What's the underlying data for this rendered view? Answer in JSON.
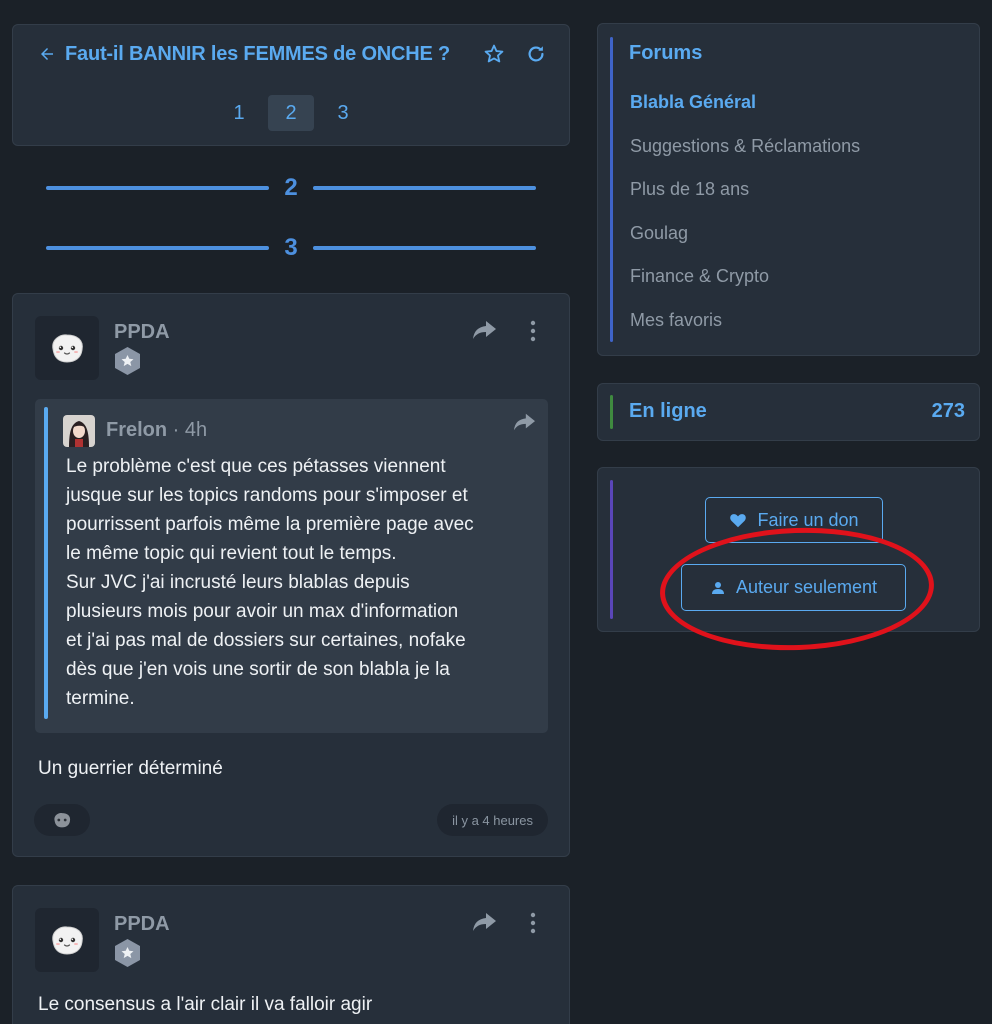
{
  "topic": {
    "title": "Faut-il BANNIR les FEMMES de ONCHE ?",
    "pages": [
      "1",
      "2",
      "3"
    ],
    "current_page": "2"
  },
  "separators": [
    "2",
    "3"
  ],
  "posts": [
    {
      "author": "PPDA",
      "quote": {
        "author": "Frelon",
        "time": " · 4h",
        "text": "Le problème c'est que ces pétasses viennent\njusque sur les topics randoms pour s'imposer et\npourrissent parfois même la première page avec\nle même topic qui revient tout le temps.\nSur JVC j'ai incrusté leurs blablas depuis\nplusieurs mois pour avoir un max d'information\net j'ai pas mal de dossiers sur certaines, nofake\ndès que j'en vois une sortir de son blabla je la\ntermine."
      },
      "body": "Un guerrier déterminé",
      "time": "il y a 4 heures"
    },
    {
      "author": "PPDA",
      "body": "Le consensus a l'air clair il va falloir agir"
    }
  ],
  "sidebar": {
    "forums_title": "Forums",
    "forums": [
      "Blabla Général",
      "Suggestions & Réclamations",
      "Plus de 18 ans",
      "Goulag",
      "Finance & Crypto",
      "Mes favoris"
    ],
    "online_label": "En ligne",
    "online_count": "273",
    "donate_label": "Faire un don",
    "author_only_label": "Auteur seulement"
  },
  "icons": {
    "back": "arrow-left-icon",
    "favorite": "star-outline-icon",
    "refresh": "refresh-icon",
    "share": "share-arrow-icon",
    "menu": "vertical-dots-icon",
    "heart": "heart-icon",
    "user": "user-icon"
  },
  "colors": {
    "accent": "#5aaaf0",
    "separator": "#4d90df",
    "annotation": "#e0121b",
    "online_bar": "#3f8a3f",
    "action_bar": "#5a46b8"
  }
}
